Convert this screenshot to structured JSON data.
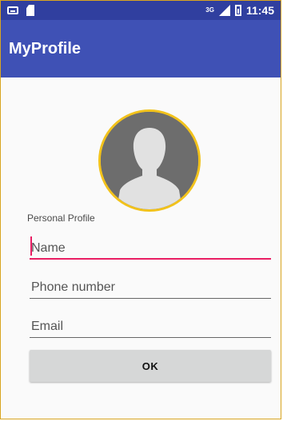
{
  "status_bar": {
    "network_badge": "3G",
    "time": "11:45",
    "icons": [
      "keyboard-icon",
      "sd-card-icon",
      "signal-icon",
      "battery-icon"
    ]
  },
  "app_bar": {
    "title": "MyProfile"
  },
  "profile": {
    "avatar_icon": "person-silhouette-icon",
    "section_label": "Personal Profile",
    "name_placeholder": "Name",
    "phone_placeholder": "Phone number",
    "email_placeholder": "Email",
    "ok_label": "OK"
  },
  "colors": {
    "status_bar": "#303f9f",
    "primary": "#3f51b5",
    "accent": "#e91e63",
    "avatar_border": "#f2c21b",
    "button": "#d6d7d7"
  }
}
